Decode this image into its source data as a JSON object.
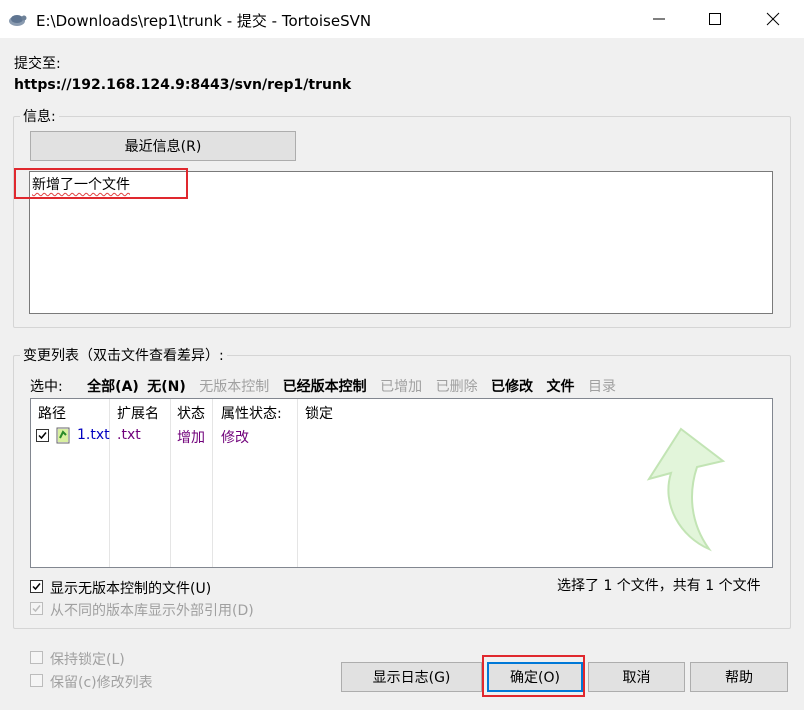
{
  "window": {
    "title": "E:\\Downloads\\rep1\\trunk - 提交 - TortoiseSVN"
  },
  "commit_to": {
    "label": "提交至:",
    "url": "https://192.168.124.9:8443/svn/rep1/trunk"
  },
  "message_group": {
    "title": "信息:",
    "recent_button": "最近信息(R)",
    "message_text": "新增了一个文件"
  },
  "changes_group": {
    "title": "变更列表（双击文件查看差异）:",
    "select_label": "选中:",
    "filters": [
      {
        "label": "全部(A)",
        "enabled": true
      },
      {
        "label": "无(N)",
        "enabled": true
      },
      {
        "label": "无版本控制",
        "enabled": false
      },
      {
        "label": "已经版本控制",
        "enabled": true
      },
      {
        "label": "已增加",
        "enabled": false
      },
      {
        "label": "已删除",
        "enabled": false
      },
      {
        "label": "已修改",
        "enabled": true
      },
      {
        "label": "文件",
        "enabled": true
      },
      {
        "label": "目录",
        "enabled": false
      }
    ],
    "columns": [
      "路径",
      "扩展名",
      "状态",
      "属性状态:",
      "锁定"
    ],
    "rows": [
      {
        "checked": true,
        "path": "1.txt",
        "ext": ".txt",
        "status": "增加",
        "prop_status": "修改",
        "lock": ""
      }
    ],
    "show_unversioned": "显示无版本控制的文件(U)",
    "show_externals": "从不同的版本库显示外部引用(D)",
    "summary": "选择了 1 个文件，共有 1 个文件"
  },
  "options": {
    "keep_locks": "保持锁定(L)",
    "keep_changelist": "保留(c)修改列表"
  },
  "buttons": {
    "show_log": "显示日志(G)",
    "ok": "确定(O)",
    "cancel": "取消",
    "help": "帮助"
  },
  "colors": {
    "accent": "#0078d7",
    "highlight_red": "#e0282e",
    "added_text": "#70007a",
    "path_text": "#0000c0"
  }
}
